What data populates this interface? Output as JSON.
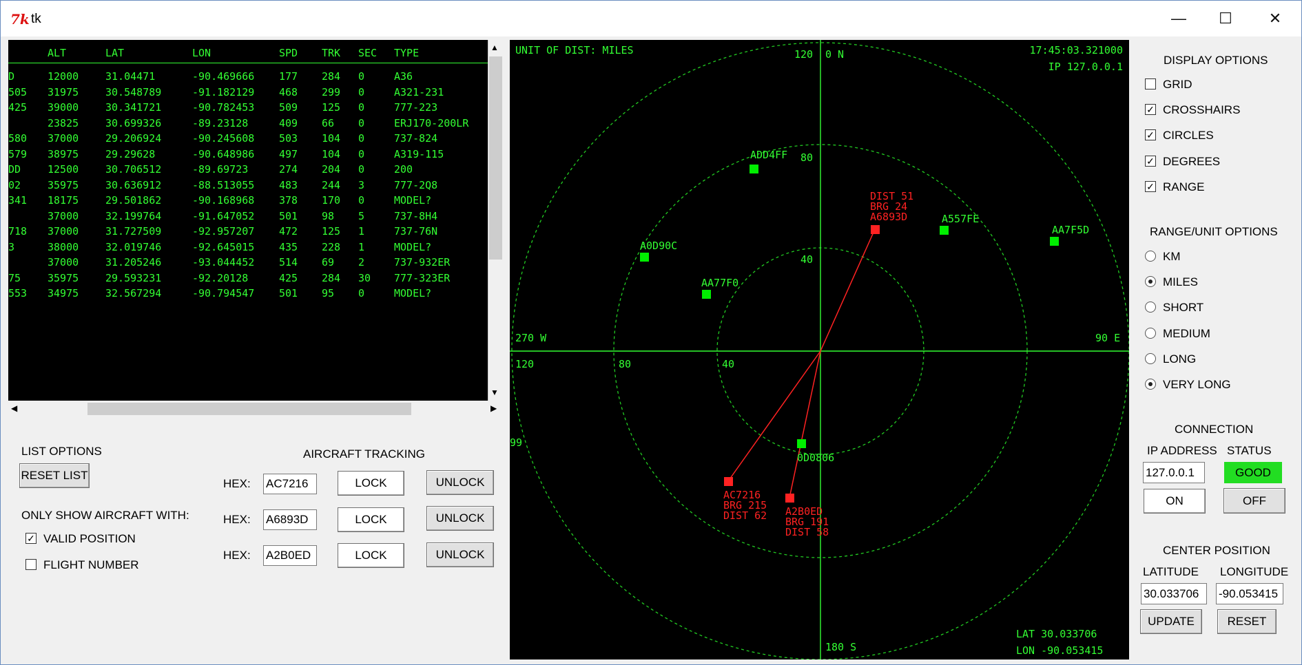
{
  "window": {
    "title": "tk",
    "icon": "tk-feather-icon",
    "min": "—",
    "max": "☐",
    "close": "✕"
  },
  "list": {
    "headers": [
      "ALT",
      "LAT",
      "LON",
      "SPD",
      "TRK",
      "SEC",
      "TYPE"
    ],
    "rows": [
      {
        "hex": "D",
        "alt": "12000",
        "lat": "31.04471",
        "lon": "-90.469666",
        "spd": "177",
        "trk": "284",
        "sec": "0",
        "type": "A36"
      },
      {
        "hex": "505",
        "alt": "31975",
        "lat": "30.548789",
        "lon": "-91.182129",
        "spd": "468",
        "trk": "299",
        "sec": "0",
        "type": "A321-231"
      },
      {
        "hex": "425",
        "alt": "39000",
        "lat": "30.341721",
        "lon": "-90.782453",
        "spd": "509",
        "trk": "125",
        "sec": "0",
        "type": "777-223"
      },
      {
        "hex": "",
        "alt": "23825",
        "lat": "30.699326",
        "lon": "-89.23128",
        "spd": "409",
        "trk": "66",
        "sec": "0",
        "type": "ERJ170-200LR"
      },
      {
        "hex": "580",
        "alt": "37000",
        "lat": "29.206924",
        "lon": "-90.245608",
        "spd": "503",
        "trk": "104",
        "sec": "0",
        "type": "737-824"
      },
      {
        "hex": "579",
        "alt": "38975",
        "lat": "29.29628",
        "lon": "-90.648986",
        "spd": "497",
        "trk": "104",
        "sec": "0",
        "type": "A319-115"
      },
      {
        "hex": "DD",
        "alt": "12500",
        "lat": "30.706512",
        "lon": "-89.69723",
        "spd": "274",
        "trk": "204",
        "sec": "0",
        "type": "200"
      },
      {
        "hex": "02",
        "alt": "35975",
        "lat": "30.636912",
        "lon": "-88.513055",
        "spd": "483",
        "trk": "244",
        "sec": "3",
        "type": "777-2Q8"
      },
      {
        "hex": "341",
        "alt": "18175",
        "lat": "29.501862",
        "lon": "-90.168968",
        "spd": "378",
        "trk": "170",
        "sec": "0",
        "type": "MODEL?"
      },
      {
        "hex": "",
        "alt": "37000",
        "lat": "32.199764",
        "lon": "-91.647052",
        "spd": "501",
        "trk": "98",
        "sec": "5",
        "type": "737-8H4"
      },
      {
        "hex": "718",
        "alt": "37000",
        "lat": "31.727509",
        "lon": "-92.957207",
        "spd": "472",
        "trk": "125",
        "sec": "1",
        "type": "737-76N"
      },
      {
        "hex": "3",
        "alt": "38000",
        "lat": "32.019746",
        "lon": "-92.645015",
        "spd": "435",
        "trk": "228",
        "sec": "1",
        "type": "MODEL?"
      },
      {
        "hex": "",
        "alt": "37000",
        "lat": "31.205246",
        "lon": "-93.044452",
        "spd": "514",
        "trk": "69",
        "sec": "2",
        "type": "737-932ER"
      },
      {
        "hex": "75",
        "alt": "35975",
        "lat": "29.593231",
        "lon": "-92.20128",
        "spd": "425",
        "trk": "284",
        "sec": "30",
        "type": "777-323ER"
      },
      {
        "hex": "553",
        "alt": "34975",
        "lat": "32.567294",
        "lon": "-90.794547",
        "spd": "501",
        "trk": "95",
        "sec": "0",
        "type": "MODEL?"
      }
    ],
    "scroll_up": "▲",
    "scroll_down": "▼",
    "scroll_left": "◀",
    "scroll_right": "▶"
  },
  "list_options": {
    "title": "LIST OPTIONS",
    "reset": "RESET LIST",
    "only_show": "ONLY SHOW AIRCRAFT WITH:",
    "valid_position": {
      "label": "VALID POSITION",
      "checked": true
    },
    "flight_number": {
      "label": "FLIGHT NUMBER",
      "checked": false
    }
  },
  "tracking": {
    "title": "AIRCRAFT TRACKING",
    "hex_label": "HEX:",
    "lock": "LOCK",
    "unlock": "UNLOCK",
    "hexes": [
      "AC7216",
      "A6893D",
      "A2B0ED"
    ]
  },
  "radar": {
    "unit_label": "UNIT OF DIST: MILES",
    "time": "17:45:03.321000",
    "ip": "IP  127.0.0.1",
    "north": "0 N",
    "north_range": "120",
    "east": "90 E",
    "south": "180 S",
    "west": "270 W",
    "ring_labels": [
      "40",
      "80",
      "120"
    ],
    "partial_left": "99",
    "lat_readout": "LAT   30.033706",
    "lon_readout": "LON  -90.053415",
    "aircraft_green": [
      "ADD4FF",
      "A557FE",
      "AA7F5D",
      "A0D90C",
      "AA77F0",
      "0D0806"
    ],
    "tracked": [
      {
        "hex": "A6893D",
        "dist": "DIST 51",
        "brg": "BRG 24"
      },
      {
        "hex": "AC7216",
        "dist": "DIST 62",
        "brg": "BRG 215"
      },
      {
        "hex": "A2B0ED",
        "dist": "DIST 58",
        "brg": "BRG 191"
      }
    ],
    "colors": {
      "grid": "#33ff33",
      "ring": "#22cc22",
      "target": "#00ee00",
      "tracked": "#ff2222"
    }
  },
  "display_options": {
    "title": "DISPLAY OPTIONS",
    "items": [
      {
        "label": "GRID",
        "checked": false
      },
      {
        "label": "CROSSHAIRS",
        "checked": true
      },
      {
        "label": "CIRCLES",
        "checked": true
      },
      {
        "label": "DEGREES",
        "checked": true
      },
      {
        "label": "RANGE",
        "checked": true
      }
    ]
  },
  "range_options": {
    "title": "RANGE/UNIT OPTIONS",
    "items": [
      {
        "label": "KM",
        "selected": false
      },
      {
        "label": "MILES",
        "selected": true
      },
      {
        "label": "SHORT",
        "selected": false
      },
      {
        "label": "MEDIUM",
        "selected": false
      },
      {
        "label": "LONG",
        "selected": false
      },
      {
        "label": "VERY LONG",
        "selected": true
      }
    ]
  },
  "connection": {
    "title": "CONNECTION",
    "ip_label": "IP ADDRESS",
    "status_label": "STATUS",
    "ip": "127.0.0.1",
    "status": "GOOD",
    "status_color": "#22dd22",
    "on": "ON",
    "off": "OFF"
  },
  "center": {
    "title": "CENTER POSITION",
    "lat_label": "LATITUDE",
    "lon_label": "LONGITUDE",
    "lat": "30.033706",
    "lon": "-90.053415",
    "update": "UPDATE",
    "reset": "RESET"
  }
}
